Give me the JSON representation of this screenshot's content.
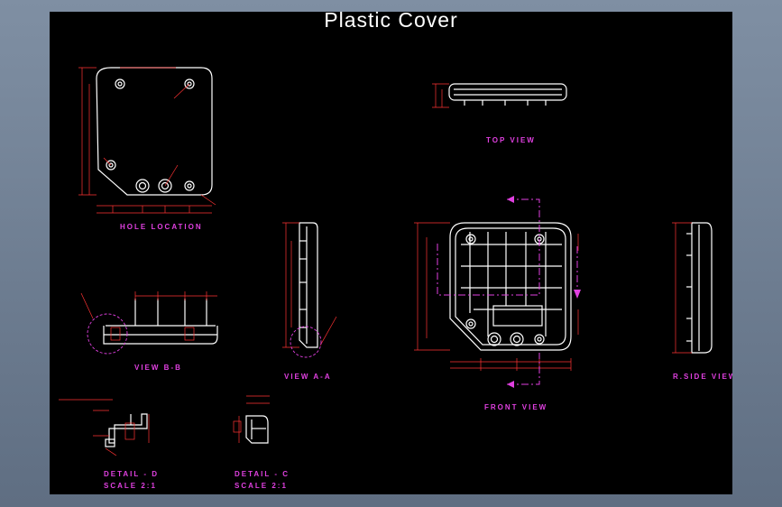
{
  "title": "Plastic Cover",
  "labels": {
    "hole_location": "HOLE LOCATION",
    "top_view": "TOP VIEW",
    "view_bb": "VIEW B-B",
    "view_aa": "VIEW A-A",
    "front_view": "FRONT VIEW",
    "rside_view": "R.SIDE VIEW",
    "detail_d": "DETAIL - D",
    "detail_d_scale": "SCALE 2:1",
    "detail_c": "DETAIL - C",
    "detail_c_scale": "SCALE 2:1"
  },
  "colors": {
    "background": "#000000",
    "outline": "#ffffff",
    "dimension": "#ff3333",
    "annotation": "#e040e0"
  }
}
